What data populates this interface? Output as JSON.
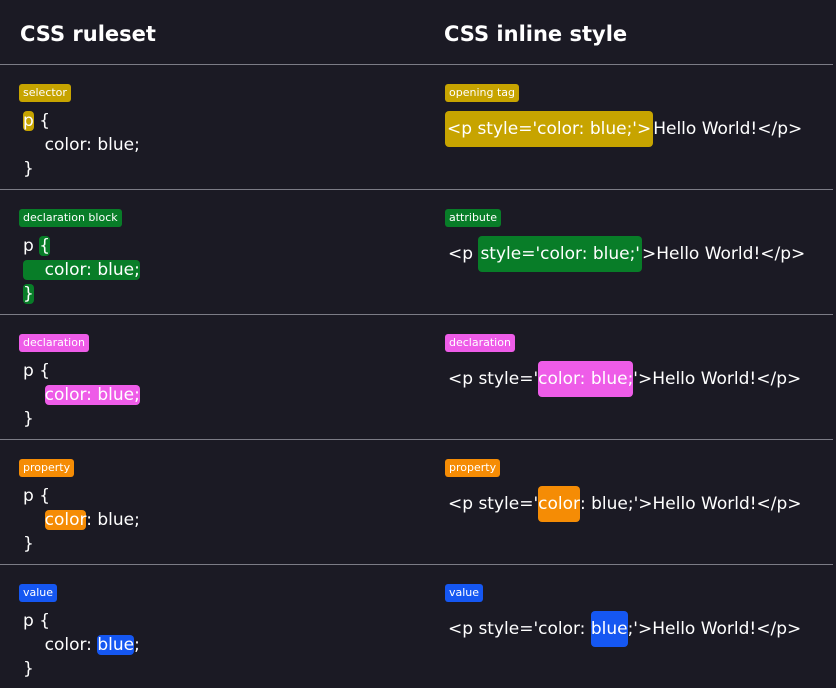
{
  "headers": {
    "left": "CSS ruleset",
    "right": "CSS inline style"
  },
  "colors": {
    "background": "#1b1a24",
    "selector": "#c7a400",
    "declaration_block": "#087d28",
    "declaration": "#ee5ce8",
    "property": "#f58c05",
    "value": "#1557f2"
  },
  "rows": [
    {
      "left_label": "selector",
      "right_label": "opening tag",
      "rule": {
        "p": "p",
        "open": " {",
        "decl": "color: blue;",
        "close": "}"
      },
      "inline": {
        "full": "<p style='color: blue;'>",
        "rest": "Hello World!</p>"
      }
    },
    {
      "left_label": "declaration block",
      "right_label": "attribute",
      "rule": {
        "p": "p ",
        "open": "{",
        "decl": "color: blue;",
        "close": "}"
      },
      "inline": {
        "pre": "<p ",
        "attr": "style='color: blue;'",
        "rest": ">Hello World!</p>"
      }
    },
    {
      "left_label": "declaration",
      "right_label": "declaration",
      "rule": {
        "p": "p {",
        "decl": "color: blue;",
        "close": "}"
      },
      "inline": {
        "pre": "<p style='",
        "decl": "color: blue;",
        "rest": "'>Hello World!</p>"
      }
    },
    {
      "left_label": "property",
      "right_label": "property",
      "rule": {
        "p": "p {",
        "prop": "color",
        "after": ": blue;",
        "close": "}"
      },
      "inline": {
        "pre": "<p style='",
        "prop": "color",
        "rest": ": blue;'>Hello World!</p>"
      }
    },
    {
      "left_label": "value",
      "right_label": "value",
      "rule": {
        "p": "p {",
        "before": "color: ",
        "val": "blue",
        "after": ";",
        "close": "}"
      },
      "inline": {
        "pre": "<p style='color: ",
        "val": "blue",
        "rest": ";'>Hello World!</p>"
      }
    }
  ]
}
